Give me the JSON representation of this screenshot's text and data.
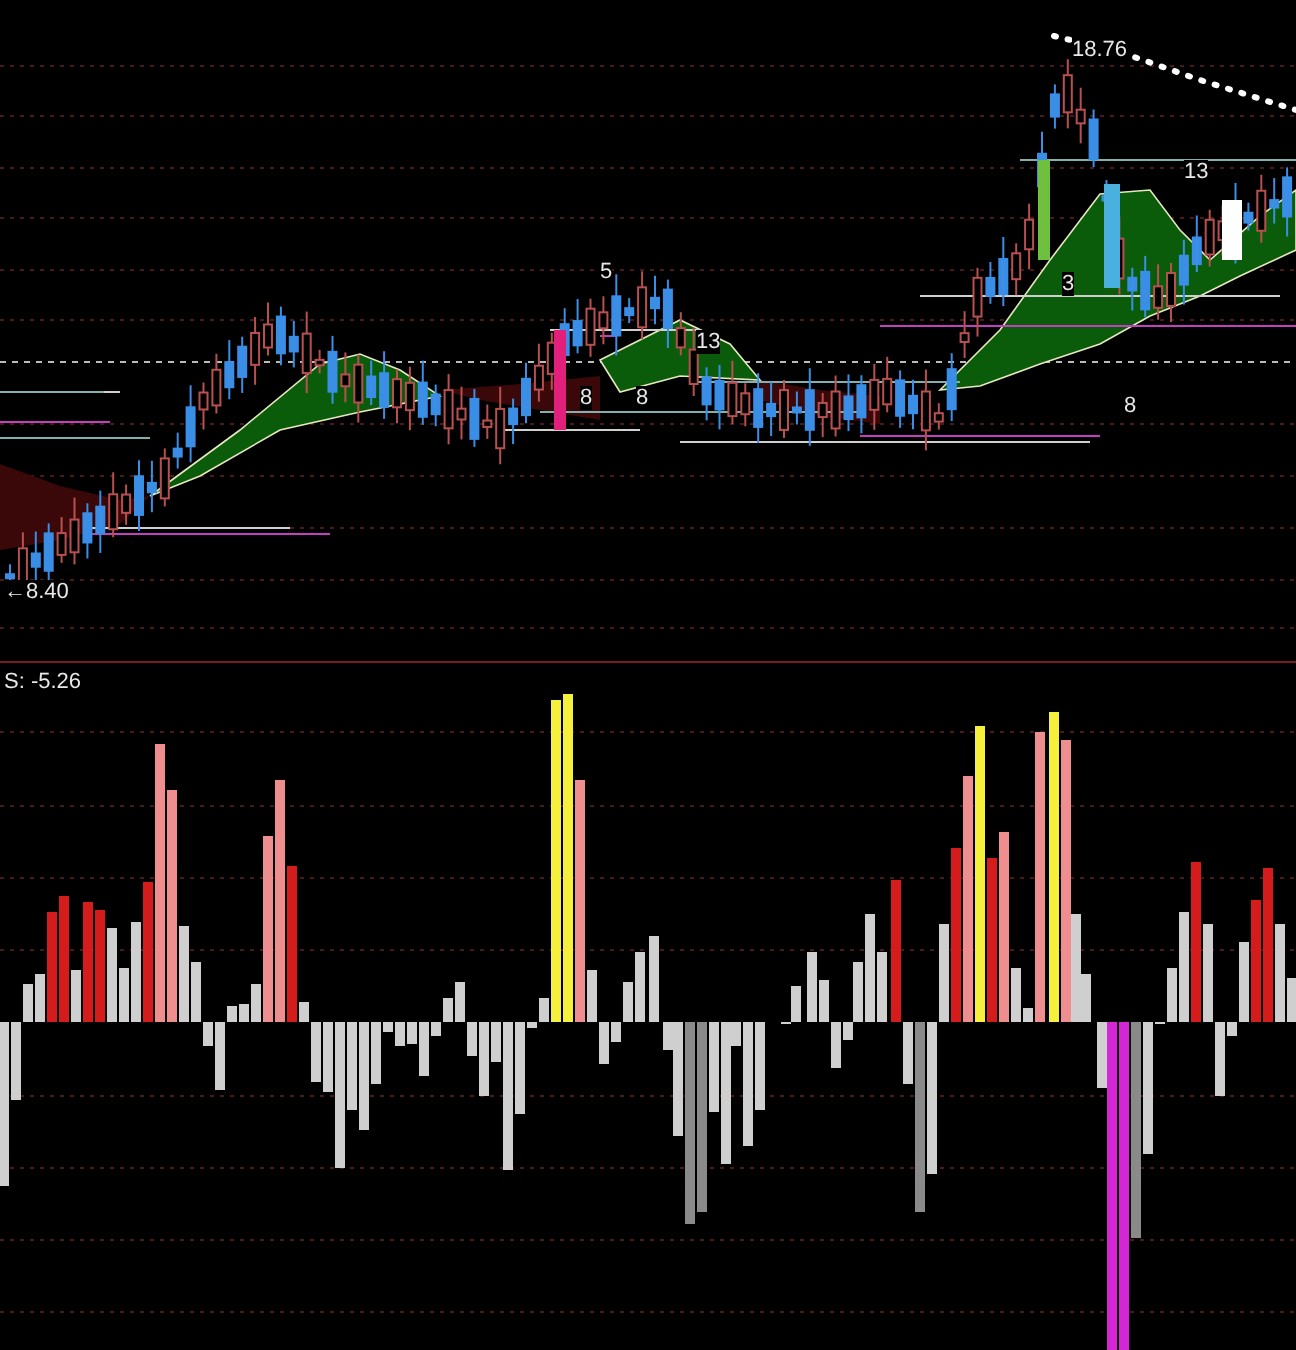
{
  "price_panel": {
    "high_label": "18.76",
    "low_label": "←8.40",
    "marks": [
      {
        "text": "5"
      },
      {
        "text": "13"
      },
      {
        "text": "8"
      },
      {
        "text": "8"
      },
      {
        "text": "3"
      },
      {
        "text": "13"
      },
      {
        "text": "8"
      }
    ]
  },
  "indicator_panel": {
    "label": "S: -5.26"
  }
}
